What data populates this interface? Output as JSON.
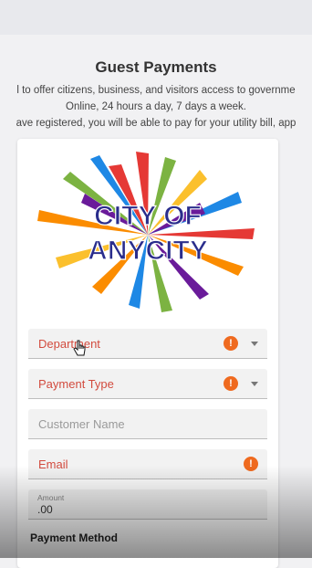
{
  "page": {
    "title": "Guest Payments",
    "intro_lines": [
      "l to offer citizens, business, and visitors access to governme",
      "Online, 24 hours a day, 7 days a week.",
      "ave registered, you will be able to pay for your utility bill, app"
    ]
  },
  "logo": {
    "line1": "CITY OF",
    "line2": "ANYCITY"
  },
  "form": {
    "department_label": "Department",
    "payment_type_label": "Payment Type",
    "customer_name_placeholder": "Customer Name",
    "email_label": "Email",
    "amount_label": "Amount",
    "amount_value": ".00",
    "payment_method_heading": "Payment Method",
    "error_mark": "!"
  },
  "colors": {
    "error_text": "#d24b3e",
    "error_badge": "#ef6a1f",
    "logo_text": "#2a2d8c"
  },
  "icons": {
    "error": "error-icon",
    "dropdown": "chevron-down-icon",
    "cursor": "hand-pointer-icon"
  }
}
